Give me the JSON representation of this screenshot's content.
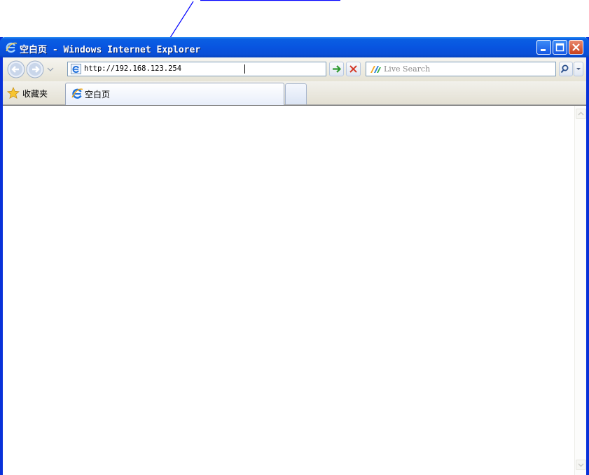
{
  "window": {
    "title": "空白页 - Windows Internet Explorer"
  },
  "address_bar": {
    "url": "http://192.168.123.254"
  },
  "search": {
    "placeholder": "Live Search"
  },
  "favorites": {
    "label": "收藏夹"
  },
  "tabs": [
    {
      "label": "空白页",
      "active": true
    }
  ],
  "colors": {
    "annotation": "#0000ff",
    "title_bar": "#0854e0",
    "window_border": "#0831d9"
  },
  "icons": {
    "back": "back-arrow-icon",
    "forward": "forward-arrow-icon",
    "go": "green-arrow-icon",
    "stop": "red-x-icon",
    "search": "magnifier-icon",
    "favorites": "star-icon",
    "page": "ie-logo-icon"
  }
}
